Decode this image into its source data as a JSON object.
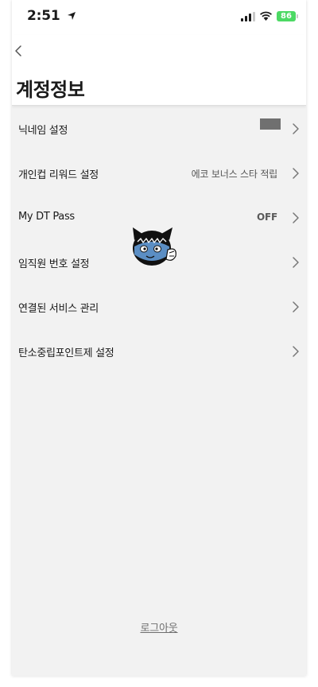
{
  "status_bar": {
    "time": "2:51",
    "battery": "86"
  },
  "header": {
    "title": "계정정보"
  },
  "menu": [
    {
      "label": "닉네임 설정",
      "value": ""
    },
    {
      "label": "개인컵 리워드 설정",
      "value": "에코 보너스 스타 적립"
    },
    {
      "label": "My DT Pass",
      "value": "OFF"
    },
    {
      "label": "임직원 번호 설정",
      "value": ""
    },
    {
      "label": "연결된 서비스 관리",
      "value": ""
    },
    {
      "label": "탄소중립포인트제 설정",
      "value": ""
    }
  ],
  "footer": {
    "logout_label": "로그아웃"
  },
  "colors": {
    "background": "#f2f2f2",
    "battery": "#4cd964",
    "nickname_box": "#707070"
  }
}
